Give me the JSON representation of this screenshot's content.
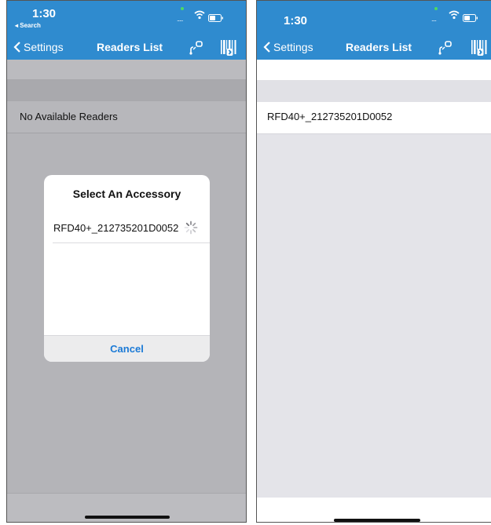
{
  "left_screen": {
    "status": {
      "time": "1:30",
      "back_app": "◂ Search",
      "signal": "....."
    },
    "nav": {
      "back_label": "Settings",
      "title": "Readers List"
    },
    "list": {
      "empty_message": "No Available Readers"
    },
    "dialog": {
      "title": "Select An Accessory",
      "items": [
        {
          "label": "RFD40+_212735201D0052"
        }
      ],
      "cancel_label": "Cancel"
    }
  },
  "right_screen": {
    "status": {
      "time": "1:30",
      "signal": "...."
    },
    "nav": {
      "back_label": "Settings",
      "title": "Readers List"
    },
    "list": {
      "rows": [
        {
          "label": "RFD40+_212735201D0052"
        }
      ]
    }
  },
  "colors": {
    "nav_bar": "#2f8bcf",
    "dimmed_overlay": "#b4b4b8",
    "list_background": "#e4e4e9",
    "cancel_text": "#1b7ad6",
    "status_dot": "#4cd964"
  },
  "icons": [
    "chevron-left-icon",
    "wifi-icon",
    "battery-icon",
    "bluetooth-link-icon",
    "bluetooth-barcode-icon",
    "spinner-icon"
  ]
}
